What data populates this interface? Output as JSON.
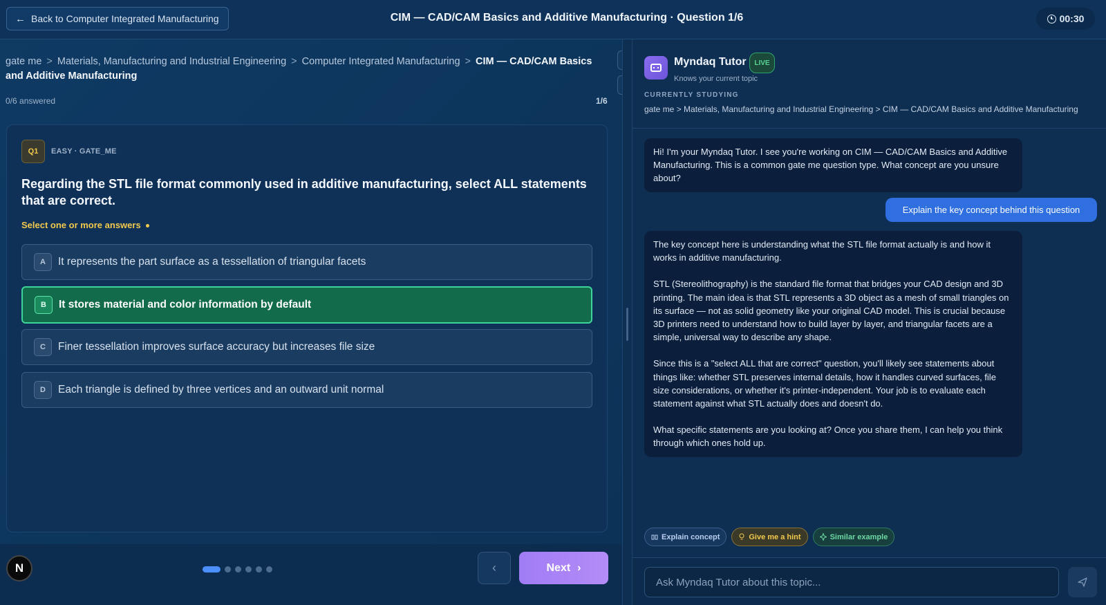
{
  "header": {
    "back_label": "Back to Computer Integrated Manufacturing",
    "title": "CIM — CAD/CAM Basics and Additive Manufacturing · Question 1/6",
    "timer": "00:30"
  },
  "breadcrumb": {
    "items": [
      "gate me",
      "Materials, Manufacturing and Industrial Engineering",
      "Computer Integrated Manufacturing"
    ],
    "current": "CIM — CAD/CAM Basics and Additive Manufacturing",
    "separator": ">"
  },
  "progress": {
    "answered": "0/6 answered",
    "count": "1/6"
  },
  "question": {
    "badge": "Q1",
    "meta": "EASY · GATE_ME",
    "text": "Regarding the STL file format commonly used in additive manufacturing, select ALL statements that are correct.",
    "hint": "Select one or more answers",
    "options": [
      {
        "letter": "A",
        "text": "It represents the part surface as a tessellation of triangular facets",
        "selected": false
      },
      {
        "letter": "B",
        "text": "It stores material and color information by default",
        "selected": true
      },
      {
        "letter": "C",
        "text": "Finer tessellation improves surface accuracy but increases file size",
        "selected": false
      },
      {
        "letter": "D",
        "text": "Each triangle is defined by three vertices and an outward unit normal",
        "selected": false
      }
    ]
  },
  "nav": {
    "avatar_letter": "N",
    "next_label": "Next",
    "total_dots": 6,
    "active_dot": 0
  },
  "tutor": {
    "name": "Myndaq Tutor",
    "live": "LIVE",
    "subtitle": "Knows your current topic",
    "studying_label": "CURRENTLY STUDYING",
    "studying_path": "gate me > Materials, Manufacturing and Industrial Engineering > CIM — CAD/CAM Basics and Additive Manufacturing",
    "messages": {
      "bot1": "Hi! I'm your Myndaq Tutor. I see you're working on CIM — CAD/CAM Basics and Additive Manufacturing. This is a common gate me question type. What concept are you unsure about?",
      "user1": "Explain the key concept behind this question",
      "bot2_p1": "The key concept here is understanding what the STL file format actually is and how it works in additive manufacturing.",
      "bot2_p2": "STL (Stereolithography) is the standard file format that bridges your CAD design and 3D printing. The main idea is that STL represents a 3D object as a mesh of small triangles on its surface — not as solid geometry like your original CAD model. This is crucial because 3D printers need to understand how to build layer by layer, and triangular facets are a simple, universal way to describe any shape.",
      "bot2_p3": "Since this is a \"select ALL that are correct\" question, you'll likely see statements about things like: whether STL preserves internal details, how it handles curved surfaces, file size considerations, or whether it's printer-independent. Your job is to evaluate each statement against what STL actually does and doesn't do.",
      "bot2_p4": "What specific statements are you looking at? Once you share them, I can help you think through which ones hold up."
    },
    "chips": {
      "explain": "Explain concept",
      "hint": "Give me a hint",
      "similar": "Similar example"
    },
    "input_placeholder": "Ask Myndaq Tutor about this topic..."
  }
}
